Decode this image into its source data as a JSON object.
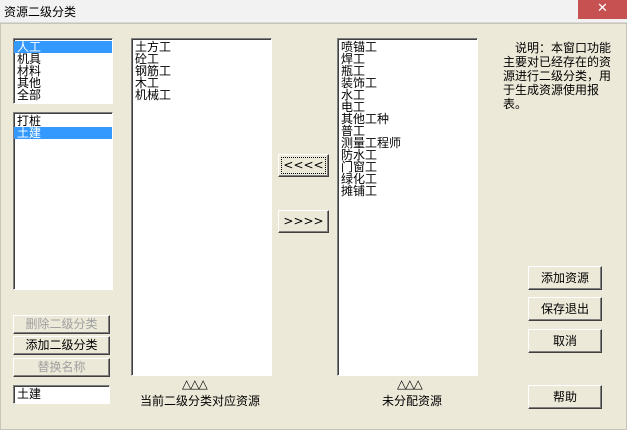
{
  "window": {
    "title": "资源二级分类",
    "close_glyph": "✕"
  },
  "top_list": {
    "items": [
      "人工",
      "机具",
      "材料",
      "其他",
      "全部"
    ],
    "selected_index": 0
  },
  "sub_list": {
    "items": [
      "打桩",
      "土建"
    ],
    "selected_index": 1
  },
  "left_buttons": {
    "delete_label": "删除二级分类",
    "add_label": "添加二级分类",
    "rename_label": "替换名称"
  },
  "name_input": {
    "value": "土建"
  },
  "current_list": {
    "items": [
      "土方工",
      "砼工",
      "钢筋工",
      "木工",
      "机械工"
    ],
    "arrows": "△△△",
    "caption": "当前二级分类对应资源"
  },
  "move_buttons": {
    "to_left": "<<<<",
    "to_right": ">>>>"
  },
  "unassigned_list": {
    "items": [
      "喷锚工",
      "焊工",
      "瓶工",
      "装饰工",
      "水工",
      "电工",
      "其他工种",
      "普工",
      "测量工程师",
      "防水工",
      "门窗工",
      "绿化工",
      "摊铺工"
    ],
    "arrows": "△△△",
    "caption": "未分配资源"
  },
  "note": "说明：本窗口功能主要对已经存在的资源进行二级分类，用于生成资源使用报表。",
  "right_buttons": {
    "add_resource": "添加资源",
    "save_exit": "保存退出",
    "cancel": "取消",
    "help": "帮助"
  }
}
